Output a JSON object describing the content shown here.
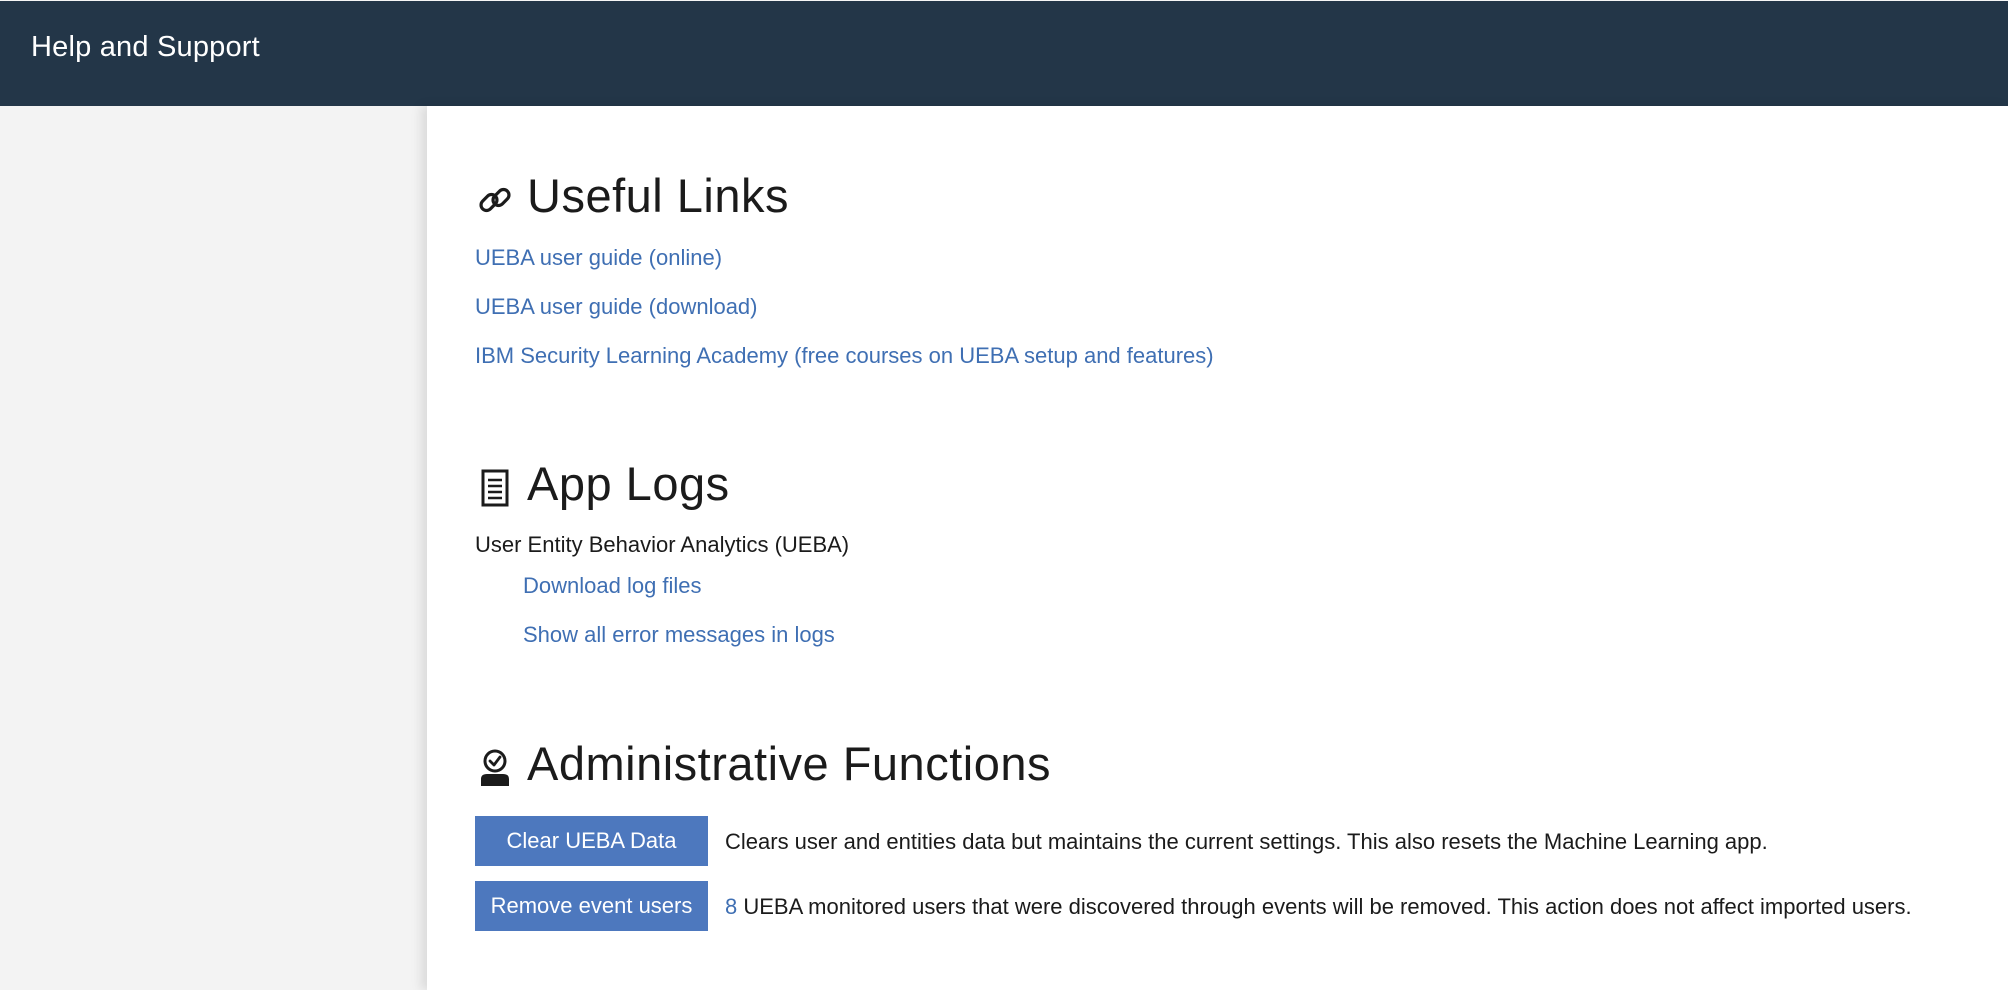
{
  "header": {
    "title": "Help and Support"
  },
  "useful_links": {
    "title": "Useful Links",
    "icon": "link-icon",
    "links": [
      "UEBA user guide (online)",
      "UEBA user guide (download)",
      "IBM Security Learning Academy (free courses on UEBA setup and features)"
    ]
  },
  "app_logs": {
    "title": "App Logs",
    "icon": "document-icon",
    "app_name": "User Entity Behavior Analytics (UEBA)",
    "links": [
      "Download log files",
      "Show all error messages in logs"
    ]
  },
  "admin": {
    "title": "Administrative Functions",
    "icon": "admin-user-icon",
    "clear_button": "Clear UEBA Data",
    "clear_description": "Clears user and entities data but maintains the current settings. This also resets the Machine Learning app.",
    "remove_button": "Remove event users",
    "remove_count": "8",
    "remove_description": "UEBA monitored users that were discovered through events will be removed. This action does not affect imported users."
  },
  "colors": {
    "header_bg": "#233648",
    "link": "#3f6fb3",
    "button_bg": "#4d78be",
    "page_bg": "#f3f3f3",
    "content_bg": "#ffffff"
  }
}
